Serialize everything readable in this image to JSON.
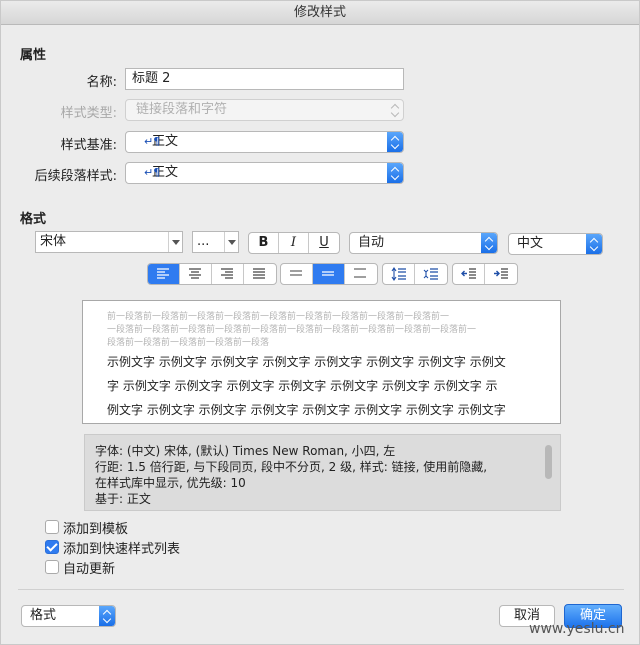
{
  "window": {
    "title": "修改样式"
  },
  "properties": {
    "heading": "属性",
    "name_label": "名称:",
    "name_value": "标题 2",
    "style_type_label": "样式类型:",
    "style_type_value": "链接段落和字符",
    "based_on_label": "样式基准:",
    "based_on_value": "正文",
    "next_style_label": "后续段落样式:",
    "next_style_value": "正文"
  },
  "format": {
    "heading": "格式",
    "font": "宋体",
    "size": "...",
    "bold": "B",
    "italic": "I",
    "underline": "U",
    "color": "自动",
    "script": "中文"
  },
  "preview": {
    "previous_paragraph_lines": [
      "前一段落前一段落前一段落前一段落前一段落前一段落前一段落前一段落前一段落前一",
      "一段落前一段落前一段落前一段落前一段落前一段落前一段落前一段落前一段落前一段落前一",
      "段落前一段落前一段落前一段落前一段落"
    ],
    "sample_lines": [
      "示例文字 示例文字 示例文字 示例文字 示例文字 示例文字 示例文字 示例文",
      "字 示例文字 示例文字 示例文字 示例文字 示例文字 示例文字 示例文字 示",
      "例文字 示例文字 示例文字 示例文字 示例文字 示例文字 示例文字 示例文字"
    ]
  },
  "description": {
    "lines": [
      "字体: (中文) 宋体, (默认) Times New Roman, 小四, 左",
      "    行距: 1.5 倍行距, 与下段同页, 段中不分页, 2 级, 样式: 链接, 使用前隐藏,",
      "在样式库中显示, 优先级: 10",
      "    基于: 正文"
    ]
  },
  "options": {
    "add_to_template": {
      "label": "添加到模板",
      "checked": false
    },
    "add_to_quick_styles": {
      "label": "添加到快速样式列表",
      "checked": true
    },
    "auto_update": {
      "label": "自动更新",
      "checked": false
    }
  },
  "footer": {
    "format_menu": "格式",
    "cancel": "取消",
    "ok": "确定"
  },
  "watermark": "www.yeslu.cn",
  "colors": {
    "accent": "#2f7bf0",
    "background": "#ececec"
  },
  "icons": {
    "align": [
      "align-left-icon",
      "align-center-icon",
      "align-right-icon",
      "justify-icon"
    ],
    "spacing": [
      "single-spacing-icon",
      "one-half-spacing-icon",
      "double-spacing-icon"
    ],
    "paragraph_spacing": [
      "decrease-paragraph-spacing-icon",
      "increase-paragraph-spacing-icon"
    ],
    "indent": [
      "decrease-indent-icon",
      "increase-indent-icon"
    ]
  }
}
